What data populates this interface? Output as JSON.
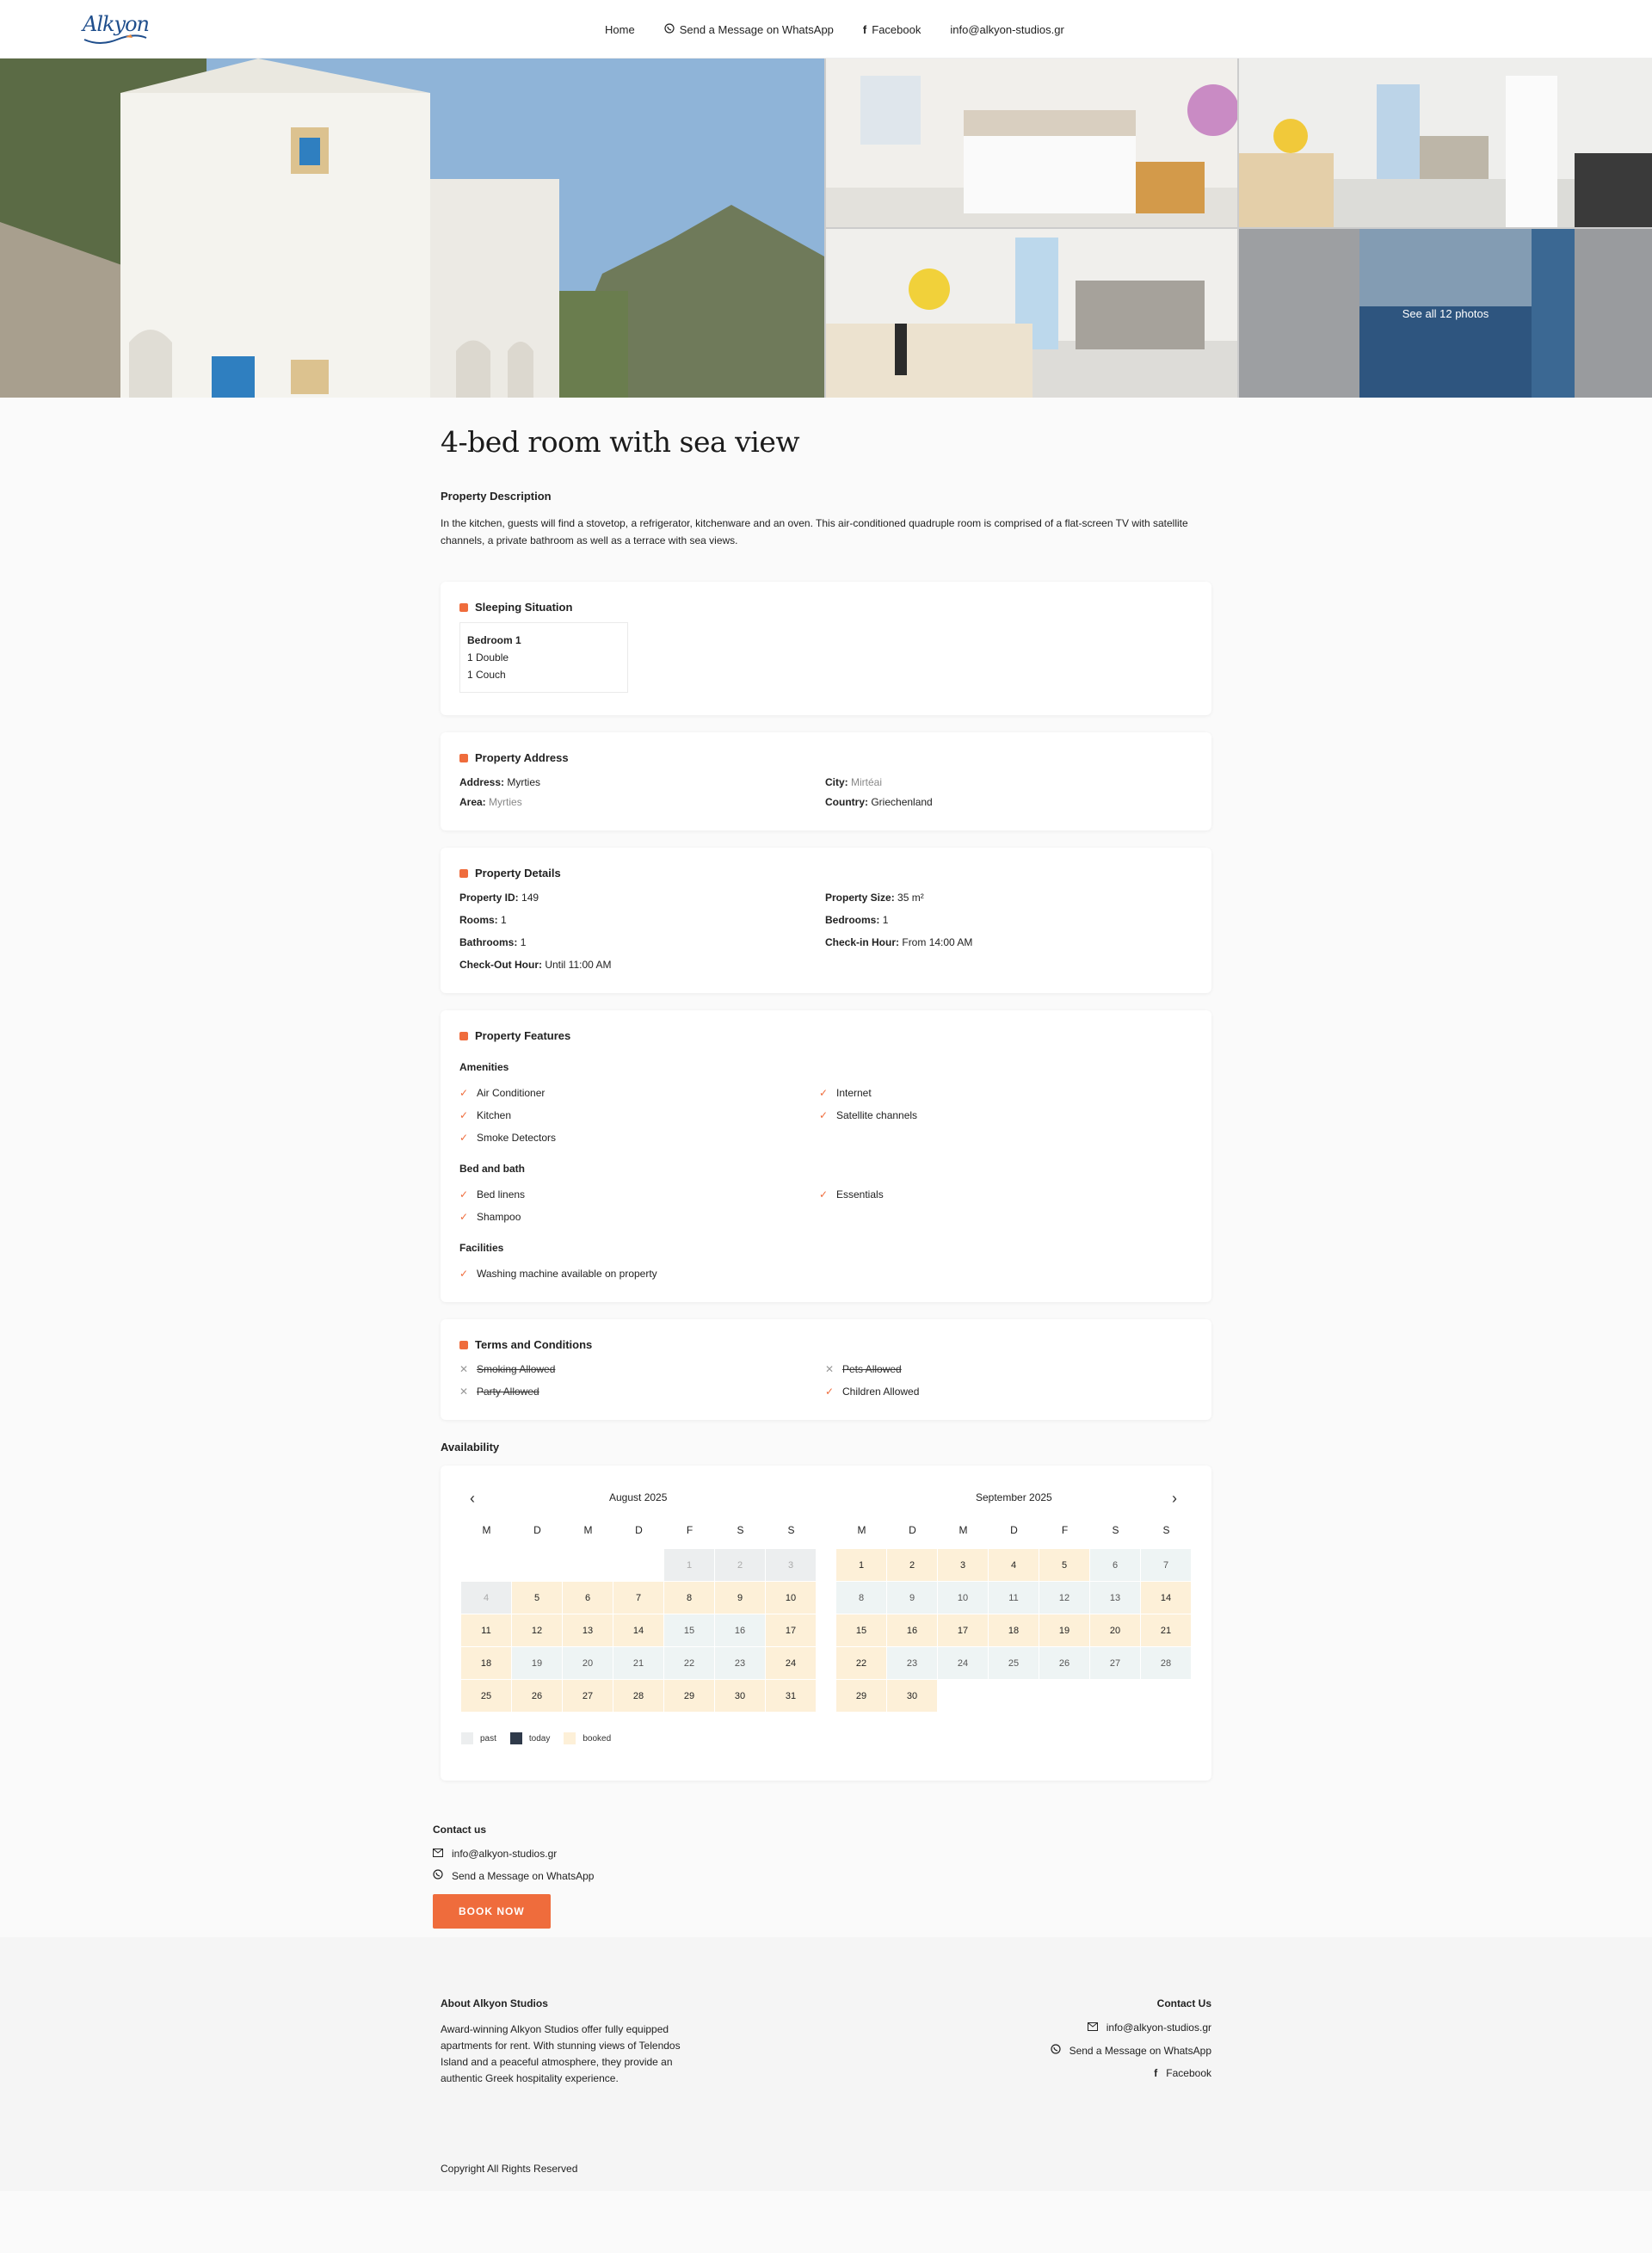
{
  "header": {
    "logo_text": "Alkyon",
    "nav": {
      "home": "Home",
      "whatsapp": "Send a Message on WhatsApp",
      "facebook": "Facebook",
      "email": "info@alkyon-studios.gr"
    }
  },
  "gallery": {
    "see_all": "See all 12 photos"
  },
  "property": {
    "title": "4-bed room with sea view",
    "description_title": "Property Description",
    "description": "In the kitchen, guests will find a stovetop, a refrigerator, kitchenware and an oven. This air-conditioned quadruple room is comprised of a flat-screen TV with satellite channels, a private bathroom as well as a terrace with sea views."
  },
  "sleeping": {
    "title": "Sleeping Situation",
    "bedroom": "Bedroom 1",
    "beds": [
      "1 Double",
      "1 Couch"
    ]
  },
  "address": {
    "title": "Property Address",
    "address_label": "Address:",
    "address_value": "Myrties",
    "city_label": "City:",
    "city_value": "Mirtéai",
    "area_label": "Area:",
    "area_value": "Myrties",
    "country_label": "Country:",
    "country_value": "Griechenland"
  },
  "details": {
    "title": "Property Details",
    "id_label": "Property ID:",
    "id_value": "149",
    "size_label": "Property Size:",
    "size_value": "35 m²",
    "rooms_label": "Rooms:",
    "rooms_value": "1",
    "bedrooms_label": "Bedrooms:",
    "bedrooms_value": "1",
    "bathrooms_label": "Bathrooms:",
    "bathrooms_value": "1",
    "checkin_label": "Check-in Hour:",
    "checkin_value": "From 14:00 AM",
    "checkout_label": "Check-Out Hour:",
    "checkout_value": "Until 11:00 AM"
  },
  "features": {
    "title": "Property Features",
    "amenities_title": "Amenities",
    "amenities": [
      "Air Conditioner",
      "Internet",
      "Kitchen",
      "Satellite channels",
      "Smoke Detectors"
    ],
    "bed_title": "Bed and bath",
    "bed": [
      "Bed linens",
      "Essentials",
      "Shampoo"
    ],
    "facilities_title": "Facilities",
    "facilities": [
      "Washing machine available on property"
    ]
  },
  "terms": {
    "title": "Terms and Conditions",
    "smoking": "Smoking Allowed",
    "pets": "Pets Allowed",
    "party": "Party Allowed",
    "children": "Children Allowed"
  },
  "availability": {
    "title": "Availability",
    "weekdays": [
      "M",
      "D",
      "M",
      "D",
      "F",
      "S",
      "S"
    ],
    "months": [
      {
        "name": "August 2025",
        "offset": 4,
        "days": 31,
        "status": [
          "past",
          "past",
          "past",
          "past",
          "booked",
          "booked",
          "booked",
          "booked",
          "booked",
          "booked",
          "booked",
          "booked",
          "booked",
          "booked",
          "free",
          "free",
          "booked",
          "booked",
          "free",
          "free",
          "free",
          "free",
          "free",
          "booked",
          "booked",
          "booked",
          "booked",
          "booked",
          "booked",
          "booked",
          "booked"
        ]
      },
      {
        "name": "September 2025",
        "offset": 0,
        "days": 30,
        "status": [
          "booked",
          "booked",
          "booked",
          "booked",
          "booked",
          "free",
          "free",
          "free",
          "free",
          "free",
          "free",
          "free",
          "free",
          "booked",
          "booked",
          "booked",
          "booked",
          "booked",
          "booked",
          "booked",
          "booked",
          "booked",
          "free",
          "free",
          "free",
          "free",
          "free",
          "free",
          "booked",
          "booked"
        ]
      }
    ],
    "legend": {
      "past": "past",
      "today": "today",
      "booked": "booked"
    },
    "legend_colors": {
      "past": "#eceeef",
      "today": "#2f3a4a",
      "booked": "#fdf0d8"
    }
  },
  "contact": {
    "title": "Contact us",
    "email": "info@alkyon-studios.gr",
    "whatsapp": "Send a Message on WhatsApp",
    "book_now": "BOOK NOW"
  },
  "footer": {
    "about_title": "About Alkyon Studios",
    "about_text": "Award-winning Alkyon Studios offer fully equipped apartments for rent. With stunning views of Telendos Island and a peaceful atmosphere, they provide an authentic Greek hospitality experience.",
    "contact_title": "Contact Us",
    "email": "info@alkyon-studios.gr",
    "whatsapp": "Send a Message on WhatsApp",
    "facebook": "Facebook",
    "copyright": "Copyright All Rights Reserved"
  },
  "colors": {
    "accent": "#ef6c3c",
    "logo": "#1f4e8c"
  }
}
